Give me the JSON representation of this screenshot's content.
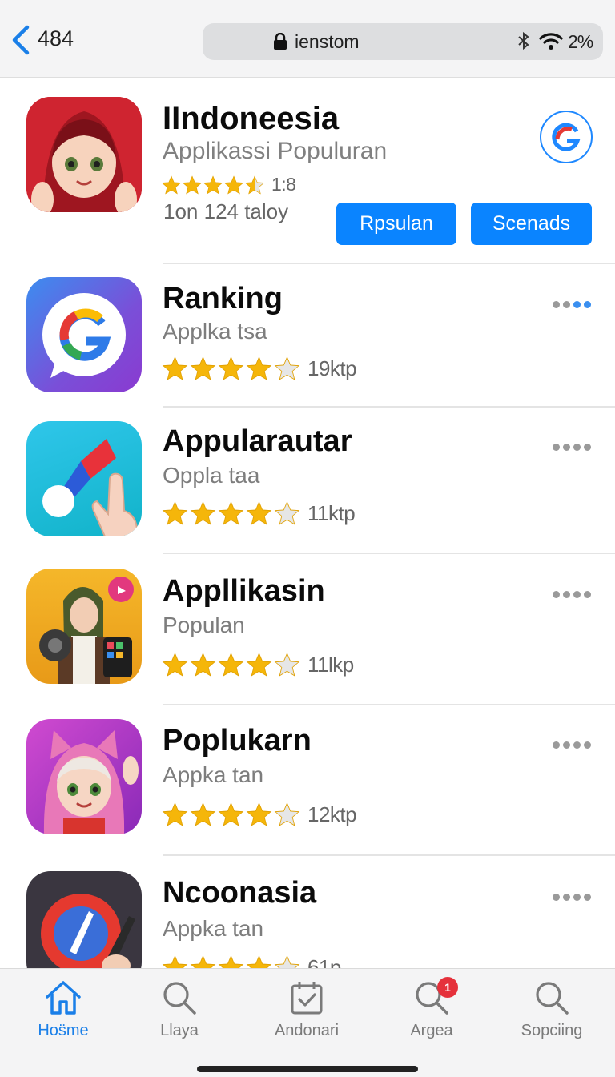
{
  "topbar": {
    "back_count": "484",
    "url": "ienstom",
    "battery": "2%"
  },
  "featured": {
    "title": "IIndoneesia",
    "subtitle": "Applikassi Populuran",
    "rating_value": "1:8",
    "rating": 4.5,
    "meta": "1on 124 taloy",
    "button_primary": "Rpsulan",
    "button_secondary": "Scenads",
    "icon": "hijab-girl-avatar-icon"
  },
  "apps": [
    {
      "name": "Ranking",
      "subtitle": "Applka tsa",
      "rating": 4,
      "count": "19ktp",
      "icon": "chat-g-icon"
    },
    {
      "name": "Appularautar",
      "subtitle": "Oppla taa",
      "rating": 4,
      "count": "11ktp",
      "icon": "pointer-hand-icon"
    },
    {
      "name": "Appllikasin",
      "subtitle": "Populan",
      "rating": 4,
      "count": "11lkp",
      "icon": "woman-with-tablet-icon"
    },
    {
      "name": "Poplukarn",
      "subtitle": "Appka tan",
      "rating": 4,
      "count": "12ktp",
      "icon": "cat-hood-girl-icon"
    },
    {
      "name": "Ncoonasia",
      "subtitle": "Appka tan",
      "rating": 4,
      "count": "61p",
      "icon": "compass-pen-icon"
    }
  ],
  "tabs": [
    {
      "label": "Hos̈me",
      "icon": "home-icon",
      "active": true
    },
    {
      "label": "Llaya",
      "icon": "search-icon",
      "active": false
    },
    {
      "label": "Andonari",
      "icon": "calendar-check-icon",
      "active": false
    },
    {
      "label": "Argea",
      "icon": "search-badge-icon",
      "active": false,
      "badge": "1"
    },
    {
      "label": "Sopciing",
      "icon": "search-icon",
      "active": false
    }
  ],
  "colors": {
    "accent": "#0a84ff",
    "star": "#f5b60a",
    "badge": "#e5313b"
  }
}
